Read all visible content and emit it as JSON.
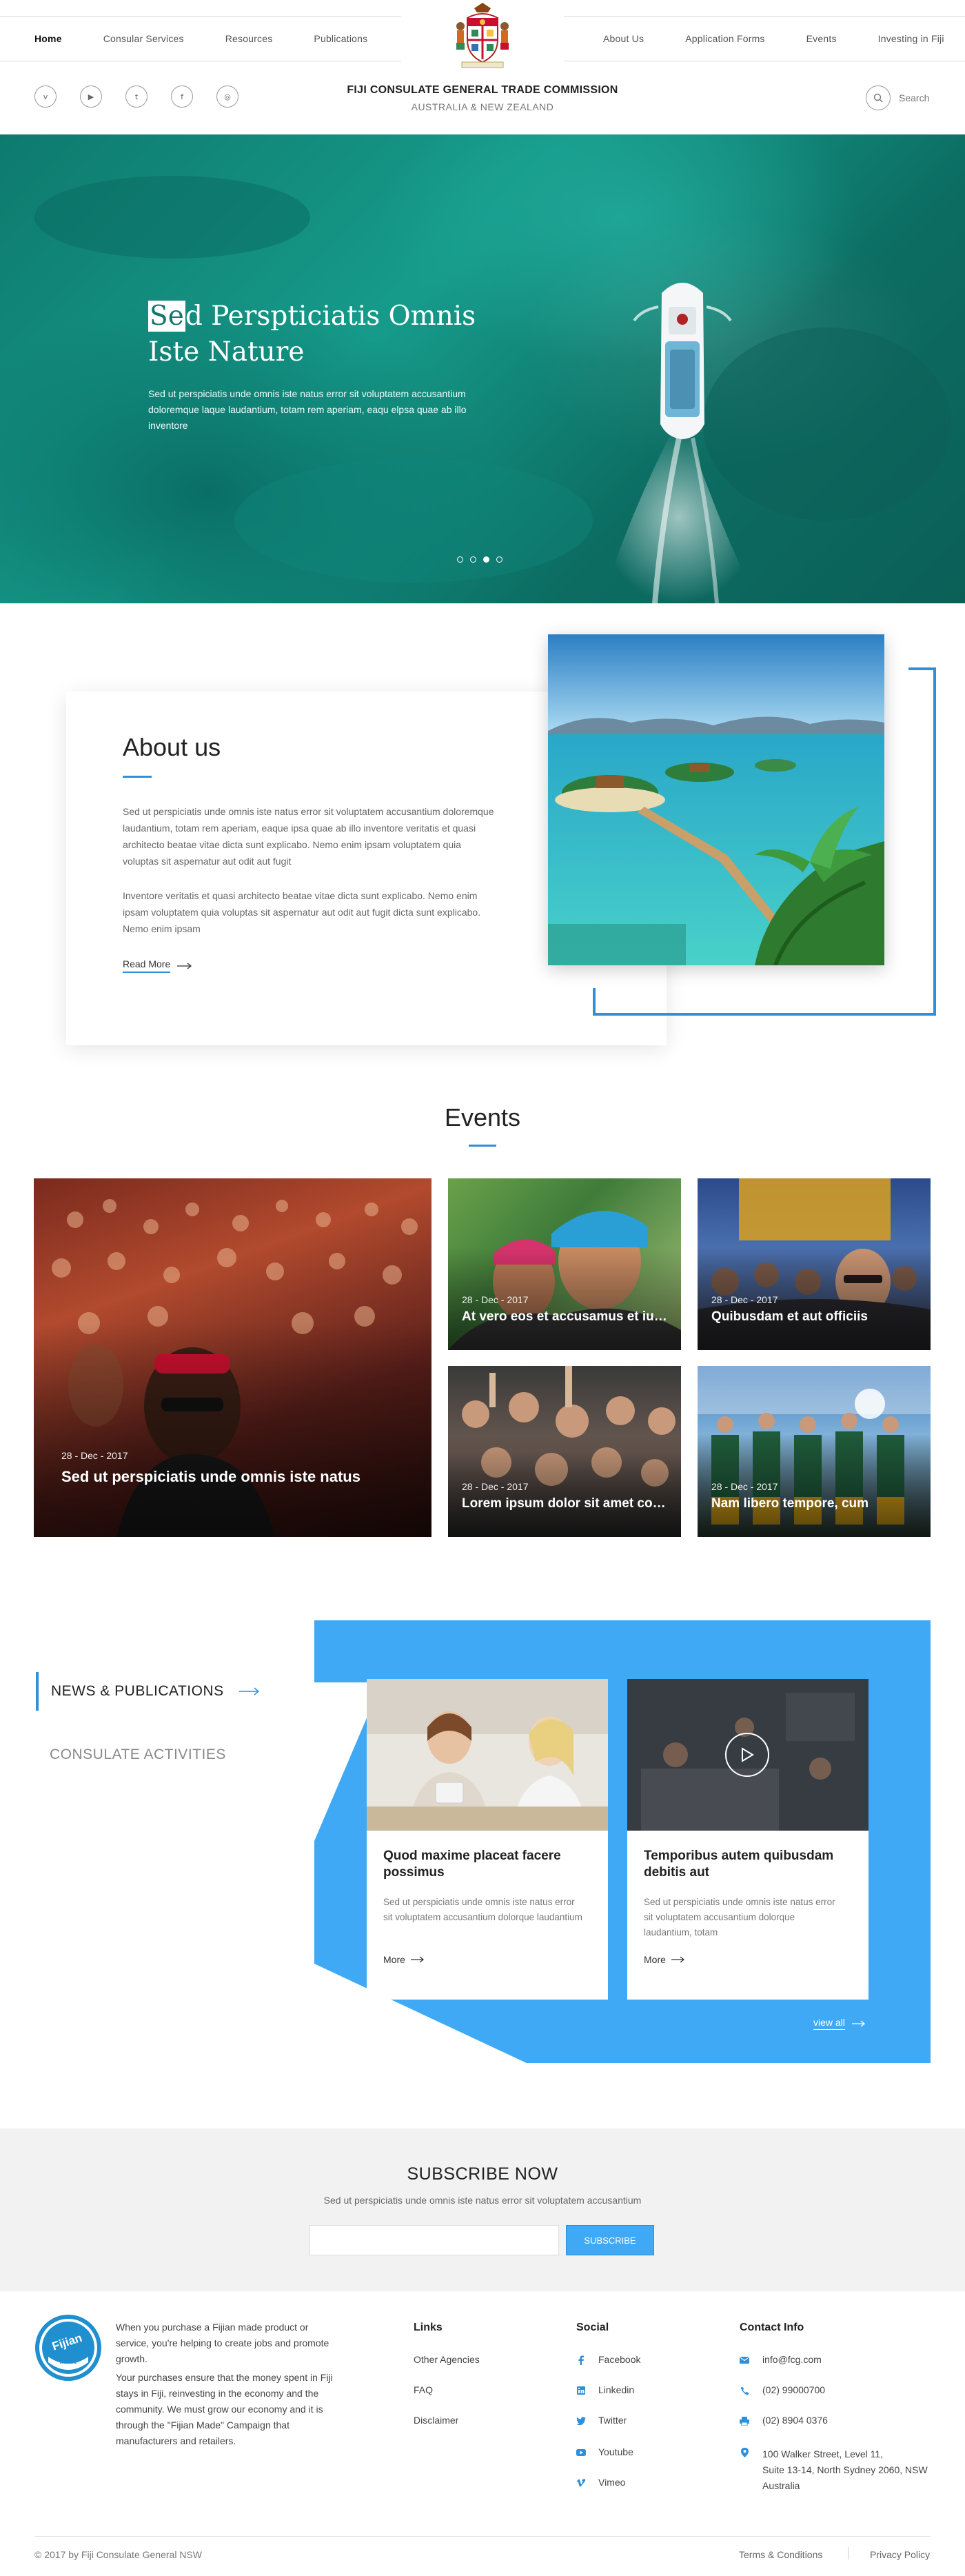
{
  "nav": {
    "left": [
      "Home",
      "Consular Services",
      "Resources",
      "Publications"
    ],
    "right": [
      "About Us",
      "Application Forms",
      "Events",
      "Investing in Fiji"
    ],
    "active": "Home"
  },
  "social_icons": [
    {
      "name": "vimeo-icon",
      "glyph": "v"
    },
    {
      "name": "youtube-icon",
      "glyph": "▶"
    },
    {
      "name": "twitter-icon",
      "glyph": "t"
    },
    {
      "name": "facebook-icon",
      "glyph": "f"
    },
    {
      "name": "instagram-icon",
      "glyph": "◎"
    }
  ],
  "brand": {
    "title": "FIJI CONSULATE GENERAL TRADE COMMISSION",
    "subtitle": "AUSTRALIA & NEW ZEALAND"
  },
  "search": {
    "label": "Search"
  },
  "hero": {
    "title_highlight": "Se",
    "title_rest": "d Perspticiatis Omnis Iste Nature",
    "text": "Sed ut perspiciatis unde omnis iste natus error sit voluptatem accusantium doloremque laque laudantium, totam rem aperiam, eaqu elpsa quae ab illo inventore",
    "slides": 4,
    "active_slide": 3
  },
  "about": {
    "title": "About us",
    "p1": "Sed ut perspiciatis unde omnis iste natus error sit voluptatem accusantium doloremque laudantium, totam rem aperiam, eaque ipsa quae ab illo inventore veritatis et quasi architecto beatae vitae dicta sunt explicabo. Nemo enim ipsam voluptatem quia voluptas sit aspernatur aut odit aut fugit",
    "p2": "Inventore veritatis et quasi architecto beatae vitae dicta sunt explicabo. Nemo enim ipsam voluptatem quia voluptas sit aspernatur aut odit aut fugit dicta sunt explicabo. Nemo enim ipsam",
    "read_more": "Read More"
  },
  "events": {
    "title": "Events",
    "items": [
      {
        "date": "28 - Dec - 2017",
        "title": "Sed ut perspiciatis unde omnis iste natus"
      },
      {
        "date": "28 - Dec - 2017",
        "title": "At vero eos et accusamus et iusto"
      },
      {
        "date": "28 - Dec - 2017",
        "title": "Quibusdam et aut officiis"
      },
      {
        "date": "28 - Dec - 2017",
        "title": "Lorem ipsum dolor sit amet consectetur"
      },
      {
        "date": "28 - Dec - 2017",
        "title": "Nam libero tempore, cum"
      }
    ]
  },
  "news": {
    "tab_active": "NEWS & PUBLICATIONS",
    "tab_inactive": "CONSULATE ACTIVITIES",
    "cards": [
      {
        "title": "Quod maxime placeat facere possimus",
        "text": "Sed ut perspiciatis unde omnis iste natus error sit voluptatem accusantium dolorque laudantium",
        "more": "More"
      },
      {
        "title": "Temporibus autem quibusdam debitis aut",
        "text": "Sed ut perspiciatis unde omnis iste natus error sit voluptatem accusantium dolorque laudantium, totam",
        "more": "More"
      }
    ],
    "view_all": "view all"
  },
  "subscribe": {
    "title": "SUBSCRIBE NOW",
    "text": "Sed ut perspiciatis unde omnis iste natus error sit voluptatem accusantium",
    "input_value": "",
    "button": "SUBSCRIBE"
  },
  "footer": {
    "logo_text_top": "Fijian",
    "logo_text_bottom": "Made",
    "about_p1": "When you purchase a Fijian made product or service, you're helping to create jobs and promote growth.",
    "about_p2": "Your purchases ensure that the money spent in Fiji stays in Fiji, reinvesting in the economy and the community. We must grow our economy and it is through the \"Fijian Made\" Campaign that manufacturers and retailers.",
    "links_title": "Links",
    "links": [
      "Other Agencies",
      "FAQ",
      "Disclaimer"
    ],
    "social_title": "Social",
    "social": [
      "Facebook",
      "Linkedin",
      "Twitter",
      "Youtube",
      "Vimeo"
    ],
    "contact_title": "Contact Info",
    "contact": [
      "info@fcg.com",
      "(02) 99000700",
      "(02) 8904 0376",
      "100 Walker Street, Level 11,",
      "Suite 13-14, North Sydney 2060, NSW",
      "Australia"
    ],
    "copyright": "© 2017 by Fiji Consulate General NSW",
    "terms": "Terms & Conditions",
    "privacy": "Privacy Policy"
  },
  "colors": {
    "accent": "#2f8fd8",
    "panel_blue": "#3fa9f5",
    "hero_sea": "#169b8a"
  }
}
